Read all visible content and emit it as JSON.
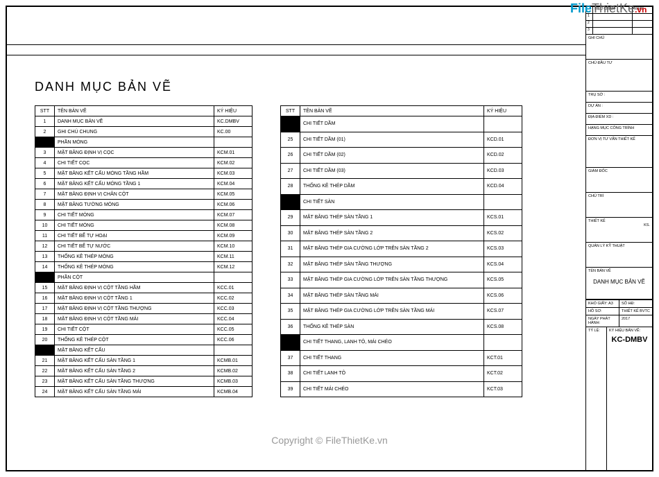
{
  "title": "DANH MỤC BẢN VẼ",
  "headers": {
    "stt": "STT",
    "name": "TÊN BẢN VẼ",
    "code": "KÝ HIỆU"
  },
  "table1": [
    {
      "stt": "1",
      "name": "DANH MỤC BẢN VẼ",
      "code": "KC.DMBV"
    },
    {
      "stt": "2",
      "name": "GHI CHÚ CHUNG",
      "code": "KC.00"
    },
    {
      "section": true,
      "name": "PHẦN MÓNG"
    },
    {
      "stt": "3",
      "name": "MẶT BẰNG ĐỊNH VỊ CỌC",
      "code": "KCM.01"
    },
    {
      "stt": "4",
      "name": "CHI TIẾT CỌC",
      "code": "KCM.02"
    },
    {
      "stt": "5",
      "name": "MẶT BẰNG KẾT CẤU MÓNG TẦNG HẦM",
      "code": "KCM.03"
    },
    {
      "stt": "6",
      "name": "MẶT BẰNG KẾT CẤU MÓNG TẦNG 1",
      "code": "KCM.04"
    },
    {
      "stt": "7",
      "name": "MẶT BẰNG ĐỊNH VỊ CHÂN CỘT",
      "code": "KCM.05"
    },
    {
      "stt": "8",
      "name": "MẶT BẰNG TƯỜNG MÓNG",
      "code": "KCM.06"
    },
    {
      "stt": "9",
      "name": "CHI TIẾT MÓNG",
      "code": "KCM.07"
    },
    {
      "stt": "10",
      "name": "CHI TIẾT MÓNG",
      "code": "KCM.08"
    },
    {
      "stt": "11",
      "name": "CHI TIẾT BỂ TỰ HOẠI",
      "code": "KCM.09"
    },
    {
      "stt": "12",
      "name": "CHI TIẾT BỂ TỰ NƯỚC",
      "code": "KCM.10"
    },
    {
      "stt": "13",
      "name": "THỐNG KÊ THÉP MÓNG",
      "code": "KCM.11"
    },
    {
      "stt": "14",
      "name": "THỐNG KÊ THÉP MÓNG",
      "code": "KCM.12"
    },
    {
      "section": true,
      "name": "PHẦN CỘT"
    },
    {
      "stt": "15",
      "name": "MẶT BẰNG ĐỊNH VỊ CỘT TẦNG HẦM",
      "code": "KCC.01"
    },
    {
      "stt": "16",
      "name": "MẶT BẰNG ĐỊNH VỊ CỘT TẦNG 1",
      "code": "KCC.02"
    },
    {
      "stt": "17",
      "name": "MẶT BẰNG ĐỊNH VỊ CỘT TẦNG THƯỢNG",
      "code": "KCC.03"
    },
    {
      "stt": "18",
      "name": "MẶT BẰNG ĐỊNH VỊ CỘT TẦNG MÁI",
      "code": "KCC.04"
    },
    {
      "stt": "19",
      "name": "CHI TIẾT CỘT",
      "code": "KCC.05"
    },
    {
      "stt": "20",
      "name": "THỐNG KÊ THÉP CỘT",
      "code": "KCC.06"
    },
    {
      "section": true,
      "name": "MẶT BẰNG KẾT CẤU"
    },
    {
      "stt": "21",
      "name": "MẶT BẰNG KẾT CẤU SÀN TẦNG 1",
      "code": "KCMB.01"
    },
    {
      "stt": "22",
      "name": "MẶT BẰNG KẾT CẤU SÀN TẦNG 2",
      "code": "KCMB.02"
    },
    {
      "stt": "23",
      "name": "MẶT BẰNG KẾT CẤU SÀN TẦNG THƯỢNG",
      "code": "KCMB.03"
    },
    {
      "stt": "24",
      "name": "MẶT BẰNG KẾT CẤU SÀN TẦNG MÁI",
      "code": "KCMB.04"
    }
  ],
  "table2": [
    {
      "section": true,
      "name": "CHI TIẾT DẦM"
    },
    {
      "stt": "25",
      "name": "CHI TIẾT DẦM (01)",
      "code": "KCD.01"
    },
    {
      "stt": "26",
      "name": "CHI TIẾT DẦM (02)",
      "code": "KCD.02"
    },
    {
      "stt": "27",
      "name": "CHI TIẾT DẦM (03)",
      "code": "KCD.03"
    },
    {
      "stt": "28",
      "name": "THỐNG KÊ THÉP DẦM",
      "code": "KCD.04"
    },
    {
      "section": true,
      "name": "CHI TIẾT SÀN"
    },
    {
      "stt": "29",
      "name": "MẶT BẰNG THÉP SÀN TẦNG 1",
      "code": "KCS.01"
    },
    {
      "stt": "30",
      "name": "MẶT BẰNG THÉP SÀN TẦNG 2",
      "code": "KCS.02"
    },
    {
      "stt": "31",
      "name": "MẶT BẰNG THÉP GIA CƯỜNG LỚP TRÊN SÀN TẦNG 2",
      "code": "KCS.03"
    },
    {
      "stt": "32",
      "name": "MẶT BẰNG THÉP SÀN TẦNG THƯỢNG",
      "code": "KCS.04"
    },
    {
      "stt": "33",
      "name": "MẶT BẰNG THÉP GIA CƯỜNG LỚP TRÊN SÀN TẦNG THƯỢNG",
      "code": "KCS.05"
    },
    {
      "stt": "34",
      "name": "MẶT BẰNG THÉP SÀN TẦNG MÁI",
      "code": "KCS.06"
    },
    {
      "stt": "35",
      "name": "MẶT BẰNG THÉP GIA CƯỜNG LỚP TRÊN SÀN TẦNG MÁI",
      "code": "KCS.07"
    },
    {
      "stt": "36",
      "name": "THỐNG KÊ THÉP SÀN",
      "code": "KCS.08"
    },
    {
      "section": true,
      "name": "CHI TIẾT THANG, LANH TÔ, MÁI CHÉO"
    },
    {
      "stt": "37",
      "name": "CHI TIẾT THANG",
      "code": "KCT.01"
    },
    {
      "stt": "38",
      "name": "CHI TIẾT LANH TÔ",
      "code": "KCT.02"
    },
    {
      "stt": "39",
      "name": "CHI TIẾT MÁI CHÉO",
      "code": "KCT.03"
    }
  ],
  "side": {
    "rev_header_lan": "HIỆU CHỈNH",
    "rev_header_nd": "",
    "rev_header_xn": "NHẬN",
    "rev1": "1",
    "rev2": "2",
    "rev3": "3",
    "ghichu": "GHI CHÚ",
    "cdt": "CHỦ ĐẦU TƯ",
    "truso": "TRỤ SỞ :",
    "duan": "DỰ ÁN :",
    "diadiem": "ĐỊA ĐIỂM XD :",
    "hangmuc": "HẠNG MỤC CÔNG TRÌNH",
    "dvtv": "ĐƠN VỊ TƯ VẤN THIẾT KẾ",
    "giamdoc": "GIÁM ĐỐC",
    "chutri": "CHỦ TRÌ",
    "thietke": "THIẾT KẾ",
    "qlkt": "QUẢN LÝ KỸ THUẬT",
    "ks": "KS.",
    "tenbanve": "TÊN BẢN VẼ",
    "sheet_title": "DANH MỤC BẢN VẼ",
    "khogiay_lbl": "KHỔ GIẤY: A3",
    "sohd_lbl": "SỐ HĐ:",
    "hoso_lbl": "HỒ SƠ:",
    "hoso_val": "THIẾT KẾ BVTC",
    "ngay_lbl": "NGÀY PHÁT HÀNH:",
    "ngay_val": "2017",
    "tyle_lbl": "TỶ LỆ:",
    "kyhieu_lbl": "KÝ HIỆU BẢN VẼ:",
    "code": "KC-DMBV"
  },
  "watermark": {
    "file": "File",
    "thietke": "ThietKe",
    "vn": ".vn",
    "copy": "Copyright © FileThietKe.vn"
  }
}
